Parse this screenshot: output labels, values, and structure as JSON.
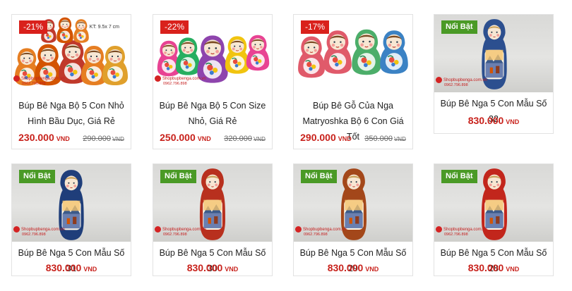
{
  "currency": "VND",
  "watermark": {
    "site": "Shopbupbenga.com.vn",
    "phone": "0962.796.898"
  },
  "products": [
    {
      "title": "Búp Bê Nga Bộ 5 Con Nhỏ Hình Bầu Dục, Giá Rẻ",
      "title_line1": "Búp Bê Nga Bộ 5 Con Nhỏ",
      "title_line2": "Hình Bầu Dục, Giá Rẻ",
      "price": "230.000",
      "old_price": "290.000",
      "badge": "-21%",
      "size_note": "KT: 9.5x 7 cm"
    },
    {
      "title": "Búp Bê Nga Bộ 5 Con Size Nhỏ, Giá Rẻ",
      "title_line1": "Búp Bê Nga Bộ 5 Con Size",
      "title_line2": "Nhỏ, Giá Rẻ",
      "price": "250.000",
      "old_price": "320.000",
      "badge": "-22%"
    },
    {
      "title": "Búp Bê Gỗ Của Nga Matryoshka Bộ 6 Con Giá Tốt",
      "title_line1": "Búp Bê Gỗ Của Nga",
      "title_line2": "Matryoshka Bộ 6 Con Giá Tốt",
      "price": "290.000",
      "old_price": "350.000",
      "badge": "-17%"
    },
    {
      "title": "Búp Bê Nga 5 Con Mẫu Số 32",
      "price": "830.000",
      "badge": "Nổi Bật"
    },
    {
      "title": "Búp Bê Nga 5 Con Mẫu Số 31",
      "price": "830.000",
      "badge": "Nổi Bật"
    },
    {
      "title": "Búp Bê Nga 5 Con Mẫu Số 30",
      "price": "830.000",
      "badge": "Nổi Bật"
    },
    {
      "title": "Búp Bê Nga 5 Con Mẫu Số 29",
      "price": "830.000",
      "badge": "Nổi Bật"
    },
    {
      "title": "Búp Bê Nga 5 Con Mẫu Số 28",
      "price": "830.000",
      "badge": "Nổi Bật"
    }
  ],
  "colors": {
    "price": "#c8211b",
    "sale_badge": "#d9211c",
    "hot_badge": "#4a9a26"
  }
}
